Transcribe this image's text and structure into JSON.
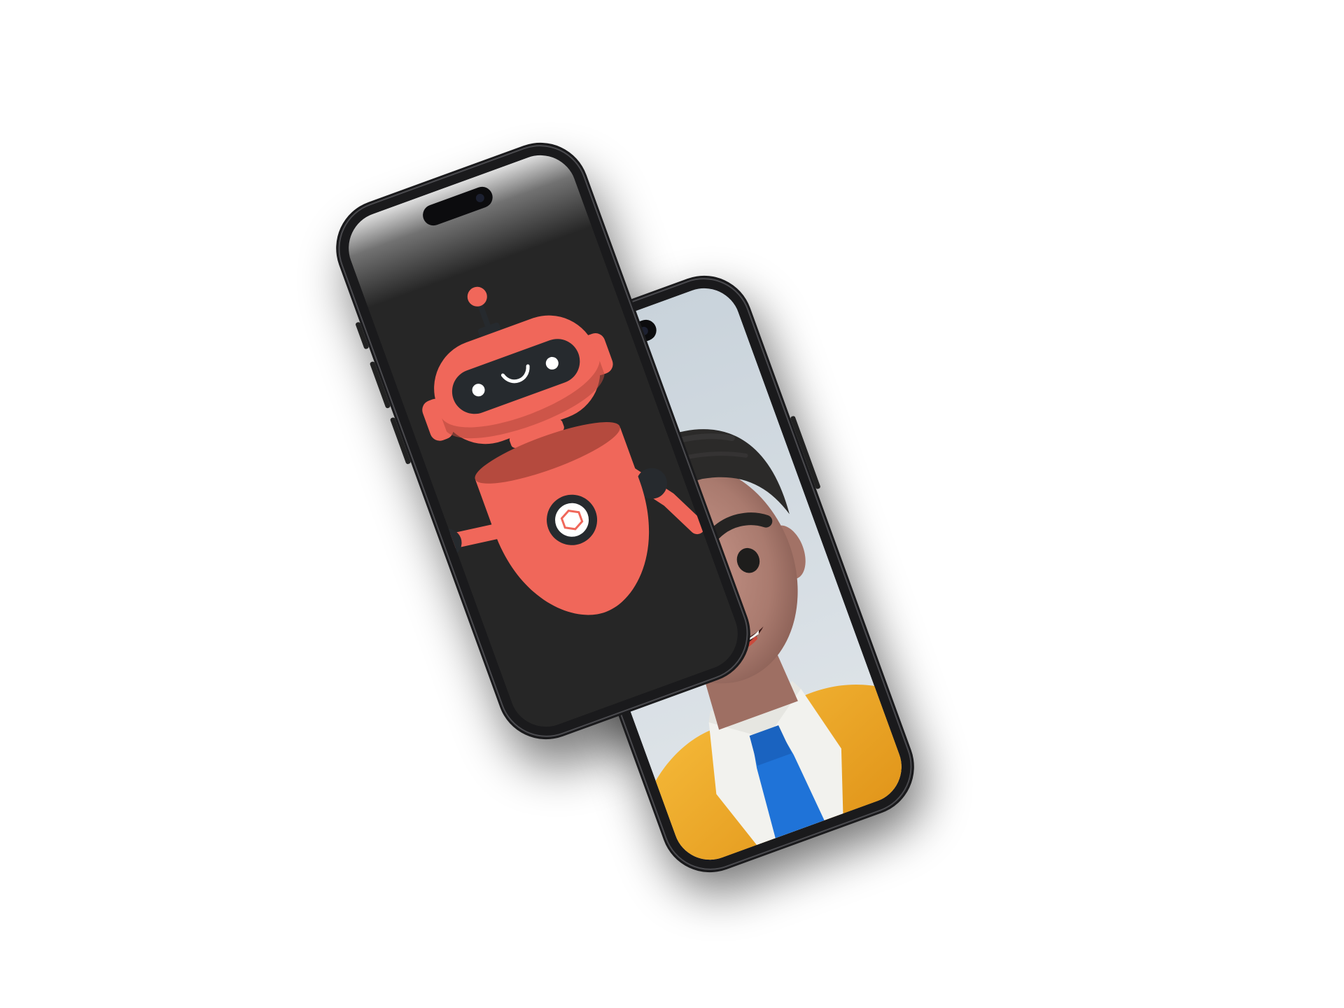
{
  "scene": {
    "background": "#ffffff",
    "devices": [
      {
        "id": "phone-back",
        "frame_color": "#1a1a1c",
        "screen_content": "3d-cartoon-man",
        "colors": {
          "backdrop": "#cfd8df",
          "skin": "#b07d70",
          "hair": "#2b2a29",
          "shirt": "#f4f4f1",
          "tie": "#1f73d8",
          "jacket": "#f3ab22"
        }
      },
      {
        "id": "phone-front",
        "frame_color": "#1a1a1c",
        "screen_content": "robot-illustration",
        "colors": {
          "backdrop": "#262626",
          "robot_body": "#f0675a",
          "robot_shade": "#b54a3e",
          "visor": "#262a2e",
          "eyes": "#ffffff",
          "emblem_ring": "#262a2e",
          "emblem_center": "#ffffff"
        }
      }
    ]
  }
}
